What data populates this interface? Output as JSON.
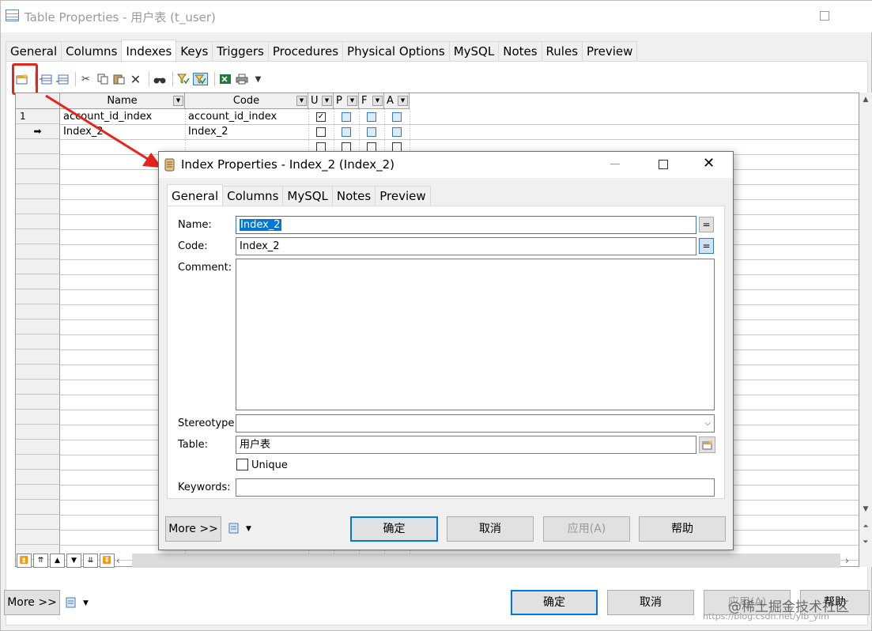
{
  "window": {
    "title": "Table Properties - 用户表 (t_user)"
  },
  "main_tabs": [
    "General",
    "Columns",
    "Indexes",
    "Keys",
    "Triggers",
    "Procedures",
    "Physical Options",
    "MySQL",
    "Notes",
    "Rules",
    "Preview"
  ],
  "selected_main_tab": "Indexes",
  "toolbar_icons": [
    "properties-icon",
    "add-row-icon",
    "insert-row-icon",
    "cut-icon",
    "copy-icon",
    "paste-icon",
    "delete-icon",
    "find-icon",
    "filter-icon",
    "customize-columns-icon",
    "excel-export-icon",
    "print-icon",
    "dropdown-arrow-icon"
  ],
  "grid": {
    "headers": {
      "name": "Name",
      "code": "Code",
      "u": "U",
      "p": "P",
      "f": "F",
      "a": "A"
    },
    "rows": [
      {
        "num": "1",
        "name": "account_id_index",
        "code": "account_id_index",
        "unique": true,
        "p": false,
        "f": false,
        "a": false
      },
      {
        "num": "➡",
        "name": "Index_2",
        "code": "Index_2",
        "unique": false,
        "p": false,
        "f": false,
        "a": false
      }
    ]
  },
  "nav_buttons": [
    "⏫",
    "⇈",
    "▲",
    "▼",
    "⇊",
    "⏬"
  ],
  "bottom": {
    "more": "More >>",
    "ok": "确定",
    "cancel": "取消",
    "apply": "应用(A)",
    "help": "帮助"
  },
  "watermark": "@稀土掘金技术社区",
  "watermark_url": "https://blog.csdn.net/ylb_ylm",
  "dialog": {
    "title": "Index Properties - Index_2 (Index_2)",
    "tabs": [
      "General",
      "Columns",
      "MySQL",
      "Notes",
      "Preview"
    ],
    "selected_tab": "General",
    "labels": {
      "name": "Name:",
      "code": "Code:",
      "comment": "Comment:",
      "stereotype": "Stereotype:",
      "table": "Table:",
      "unique": "Unique",
      "keywords": "Keywords:"
    },
    "name_value": "Index_2",
    "code_value": "Index_2",
    "comment_value": "",
    "stereotype_value": "",
    "table_value": "用户表",
    "unique_checked": false,
    "keywords_value": "",
    "eq_button": "=",
    "more": "More >>",
    "ok": "确定",
    "cancel": "取消",
    "apply": "应用(A)",
    "help": "帮助"
  },
  "colors": {
    "selection": "#0078d7",
    "highlight_box": "#e8231c",
    "arrow": "#e8231c"
  }
}
